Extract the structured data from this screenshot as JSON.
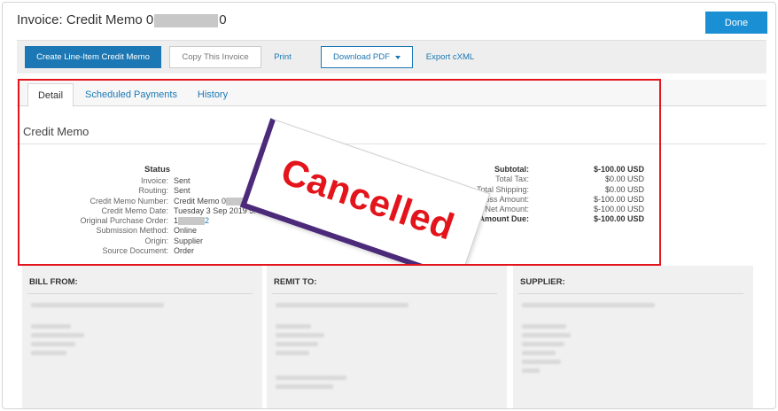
{
  "header": {
    "title_prefix": "Invoice: Credit Memo 0",
    "title_suffix": "0",
    "done_label": "Done"
  },
  "toolbar": {
    "create_label": "Create Line-Item Credit Memo",
    "copy_label": "Copy This Invoice",
    "print_label": "Print",
    "download_label": "Download PDF",
    "export_label": "Export cXML"
  },
  "tabs": [
    {
      "label": "Detail",
      "active": true
    },
    {
      "label": "Scheduled Payments",
      "active": false
    },
    {
      "label": "History",
      "active": false
    }
  ],
  "section": {
    "title": "Credit Memo",
    "status_heading": "Status",
    "fields": [
      {
        "label": "Invoice:",
        "value": "Sent"
      },
      {
        "label": "Routing:",
        "value": "Sent"
      },
      {
        "label": "Credit Memo Number:",
        "value_prefix": "Credit Memo 0",
        "value_suffix": "0"
      },
      {
        "label": "Credit Memo Date:",
        "value": "Tuesday 3 Sep 2019 5:48 PM GMT+05:30"
      },
      {
        "label": "Original Purchase Order:",
        "value_prefix": "1",
        "value_suffix": "2"
      },
      {
        "label": "Submission Method:",
        "value": "Online"
      },
      {
        "label": "Origin:",
        "value": "Supplier"
      },
      {
        "label": "Source Document:",
        "value": "Order"
      }
    ]
  },
  "totals": [
    {
      "label": "Subtotal:",
      "value": "$-100.00 USD",
      "bold": true
    },
    {
      "label": "Total Tax:",
      "value": "$0.00 USD",
      "bold": false
    },
    {
      "label": "Total Shipping:",
      "value": "$0.00 USD",
      "bold": false
    },
    {
      "label": "Gross Amount:",
      "value": "$-100.00 USD",
      "bold": false
    },
    {
      "label": "Net Amount:",
      "value": "$-100.00 USD",
      "bold": false
    },
    {
      "label": "Amount Due:",
      "value": "$-100.00 USD",
      "bold": true
    }
  ],
  "stamp": {
    "text": "Cancelled",
    "text_color": "#e3141b",
    "border_color": "#4b2a7a"
  },
  "cards": [
    {
      "title": "BILL FROM:"
    },
    {
      "title": "REMIT TO:"
    },
    {
      "title": "SUPPLIER:"
    }
  ],
  "colors": {
    "primary": "#1b78b4",
    "done": "#1a8fd4",
    "highlight": "#e3141b"
  }
}
